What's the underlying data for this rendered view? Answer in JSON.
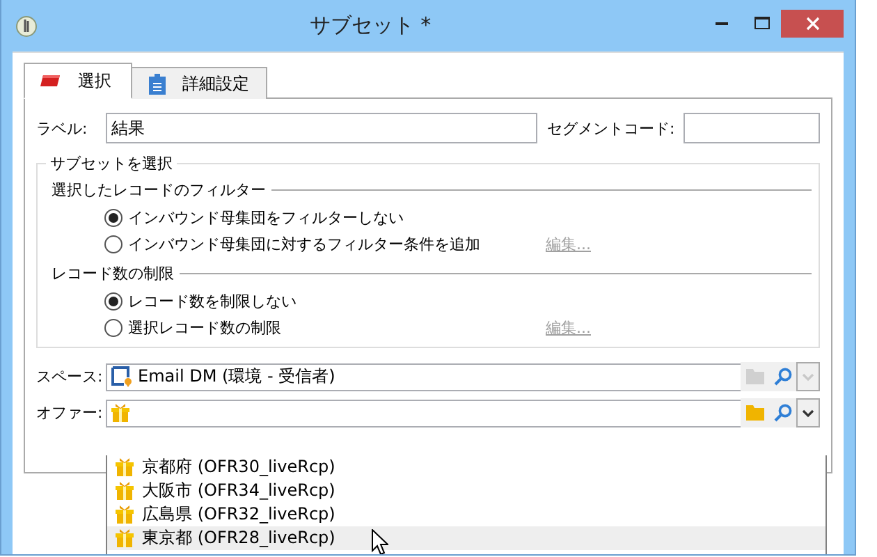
{
  "window": {
    "title": "サブセット *"
  },
  "tabs": [
    {
      "label": "選択",
      "selected": true
    },
    {
      "label": "詳細設定",
      "selected": false
    }
  ],
  "label_field": {
    "label": "ラベル:",
    "value": "結果"
  },
  "segment_code_field": {
    "label": "セグメントコード:"
  },
  "subset_group": {
    "title": "サブセットを選択",
    "sections": [
      {
        "title": "選択したレコードのフィルター",
        "options": [
          {
            "label": "インバウンド母集団をフィルターしない",
            "selected": true
          },
          {
            "label": "インバウンド母集団に対するフィルター条件を追加",
            "selected": false,
            "link": {
              "label": "編集...",
              "disabled": true
            }
          }
        ]
      },
      {
        "title": "レコード数の制限",
        "options": [
          {
            "label": "レコード数を制限しない",
            "selected": true
          },
          {
            "label": "選択レコード数の制限",
            "selected": false,
            "link": {
              "label": "編集...",
              "disabled": true
            }
          }
        ]
      }
    ]
  },
  "space_field": {
    "label": "スペース:",
    "value": "Email DM (環境 - 受信者)",
    "actions_disabled": true
  },
  "offer_field": {
    "label": "オファー:",
    "actions_disabled": false,
    "dropdown": [
      {
        "label": "京都府 (OFR30_liveRcp)",
        "selected": false
      },
      {
        "label": "大阪市 (OFR34_liveRcp)",
        "selected": false
      },
      {
        "label": "広島県 (OFR32_liveRcp)",
        "selected": false
      },
      {
        "label": "東京都 (OFR28_liveRcp)",
        "selected": true
      }
    ]
  }
}
